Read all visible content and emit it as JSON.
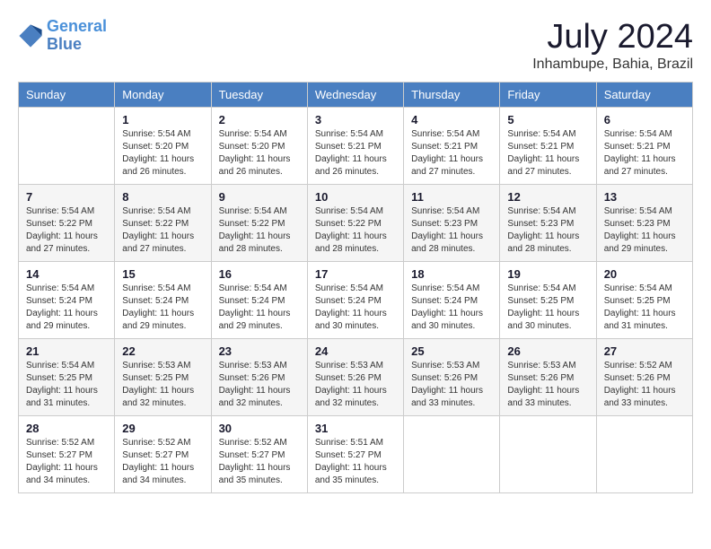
{
  "header": {
    "logo_general": "General",
    "logo_blue": "Blue",
    "month_title": "July 2024",
    "subtitle": "Inhambupe, Bahia, Brazil"
  },
  "weekdays": [
    "Sunday",
    "Monday",
    "Tuesday",
    "Wednesday",
    "Thursday",
    "Friday",
    "Saturday"
  ],
  "weeks": [
    [
      {
        "day": "",
        "sunrise": "",
        "sunset": "",
        "daylight": ""
      },
      {
        "day": "1",
        "sunrise": "Sunrise: 5:54 AM",
        "sunset": "Sunset: 5:20 PM",
        "daylight": "Daylight: 11 hours and 26 minutes."
      },
      {
        "day": "2",
        "sunrise": "Sunrise: 5:54 AM",
        "sunset": "Sunset: 5:20 PM",
        "daylight": "Daylight: 11 hours and 26 minutes."
      },
      {
        "day": "3",
        "sunrise": "Sunrise: 5:54 AM",
        "sunset": "Sunset: 5:21 PM",
        "daylight": "Daylight: 11 hours and 26 minutes."
      },
      {
        "day": "4",
        "sunrise": "Sunrise: 5:54 AM",
        "sunset": "Sunset: 5:21 PM",
        "daylight": "Daylight: 11 hours and 27 minutes."
      },
      {
        "day": "5",
        "sunrise": "Sunrise: 5:54 AM",
        "sunset": "Sunset: 5:21 PM",
        "daylight": "Daylight: 11 hours and 27 minutes."
      },
      {
        "day": "6",
        "sunrise": "Sunrise: 5:54 AM",
        "sunset": "Sunset: 5:21 PM",
        "daylight": "Daylight: 11 hours and 27 minutes."
      }
    ],
    [
      {
        "day": "7",
        "sunrise": "Sunrise: 5:54 AM",
        "sunset": "Sunset: 5:22 PM",
        "daylight": "Daylight: 11 hours and 27 minutes."
      },
      {
        "day": "8",
        "sunrise": "Sunrise: 5:54 AM",
        "sunset": "Sunset: 5:22 PM",
        "daylight": "Daylight: 11 hours and 27 minutes."
      },
      {
        "day": "9",
        "sunrise": "Sunrise: 5:54 AM",
        "sunset": "Sunset: 5:22 PM",
        "daylight": "Daylight: 11 hours and 28 minutes."
      },
      {
        "day": "10",
        "sunrise": "Sunrise: 5:54 AM",
        "sunset": "Sunset: 5:22 PM",
        "daylight": "Daylight: 11 hours and 28 minutes."
      },
      {
        "day": "11",
        "sunrise": "Sunrise: 5:54 AM",
        "sunset": "Sunset: 5:23 PM",
        "daylight": "Daylight: 11 hours and 28 minutes."
      },
      {
        "day": "12",
        "sunrise": "Sunrise: 5:54 AM",
        "sunset": "Sunset: 5:23 PM",
        "daylight": "Daylight: 11 hours and 28 minutes."
      },
      {
        "day": "13",
        "sunrise": "Sunrise: 5:54 AM",
        "sunset": "Sunset: 5:23 PM",
        "daylight": "Daylight: 11 hours and 29 minutes."
      }
    ],
    [
      {
        "day": "14",
        "sunrise": "Sunrise: 5:54 AM",
        "sunset": "Sunset: 5:24 PM",
        "daylight": "Daylight: 11 hours and 29 minutes."
      },
      {
        "day": "15",
        "sunrise": "Sunrise: 5:54 AM",
        "sunset": "Sunset: 5:24 PM",
        "daylight": "Daylight: 11 hours and 29 minutes."
      },
      {
        "day": "16",
        "sunrise": "Sunrise: 5:54 AM",
        "sunset": "Sunset: 5:24 PM",
        "daylight": "Daylight: 11 hours and 29 minutes."
      },
      {
        "day": "17",
        "sunrise": "Sunrise: 5:54 AM",
        "sunset": "Sunset: 5:24 PM",
        "daylight": "Daylight: 11 hours and 30 minutes."
      },
      {
        "day": "18",
        "sunrise": "Sunrise: 5:54 AM",
        "sunset": "Sunset: 5:24 PM",
        "daylight": "Daylight: 11 hours and 30 minutes."
      },
      {
        "day": "19",
        "sunrise": "Sunrise: 5:54 AM",
        "sunset": "Sunset: 5:25 PM",
        "daylight": "Daylight: 11 hours and 30 minutes."
      },
      {
        "day": "20",
        "sunrise": "Sunrise: 5:54 AM",
        "sunset": "Sunset: 5:25 PM",
        "daylight": "Daylight: 11 hours and 31 minutes."
      }
    ],
    [
      {
        "day": "21",
        "sunrise": "Sunrise: 5:54 AM",
        "sunset": "Sunset: 5:25 PM",
        "daylight": "Daylight: 11 hours and 31 minutes."
      },
      {
        "day": "22",
        "sunrise": "Sunrise: 5:53 AM",
        "sunset": "Sunset: 5:25 PM",
        "daylight": "Daylight: 11 hours and 32 minutes."
      },
      {
        "day": "23",
        "sunrise": "Sunrise: 5:53 AM",
        "sunset": "Sunset: 5:26 PM",
        "daylight": "Daylight: 11 hours and 32 minutes."
      },
      {
        "day": "24",
        "sunrise": "Sunrise: 5:53 AM",
        "sunset": "Sunset: 5:26 PM",
        "daylight": "Daylight: 11 hours and 32 minutes."
      },
      {
        "day": "25",
        "sunrise": "Sunrise: 5:53 AM",
        "sunset": "Sunset: 5:26 PM",
        "daylight": "Daylight: 11 hours and 33 minutes."
      },
      {
        "day": "26",
        "sunrise": "Sunrise: 5:53 AM",
        "sunset": "Sunset: 5:26 PM",
        "daylight": "Daylight: 11 hours and 33 minutes."
      },
      {
        "day": "27",
        "sunrise": "Sunrise: 5:52 AM",
        "sunset": "Sunset: 5:26 PM",
        "daylight": "Daylight: 11 hours and 33 minutes."
      }
    ],
    [
      {
        "day": "28",
        "sunrise": "Sunrise: 5:52 AM",
        "sunset": "Sunset: 5:27 PM",
        "daylight": "Daylight: 11 hours and 34 minutes."
      },
      {
        "day": "29",
        "sunrise": "Sunrise: 5:52 AM",
        "sunset": "Sunset: 5:27 PM",
        "daylight": "Daylight: 11 hours and 34 minutes."
      },
      {
        "day": "30",
        "sunrise": "Sunrise: 5:52 AM",
        "sunset": "Sunset: 5:27 PM",
        "daylight": "Daylight: 11 hours and 35 minutes."
      },
      {
        "day": "31",
        "sunrise": "Sunrise: 5:51 AM",
        "sunset": "Sunset: 5:27 PM",
        "daylight": "Daylight: 11 hours and 35 minutes."
      },
      {
        "day": "",
        "sunrise": "",
        "sunset": "",
        "daylight": ""
      },
      {
        "day": "",
        "sunrise": "",
        "sunset": "",
        "daylight": ""
      },
      {
        "day": "",
        "sunrise": "",
        "sunset": "",
        "daylight": ""
      }
    ]
  ]
}
